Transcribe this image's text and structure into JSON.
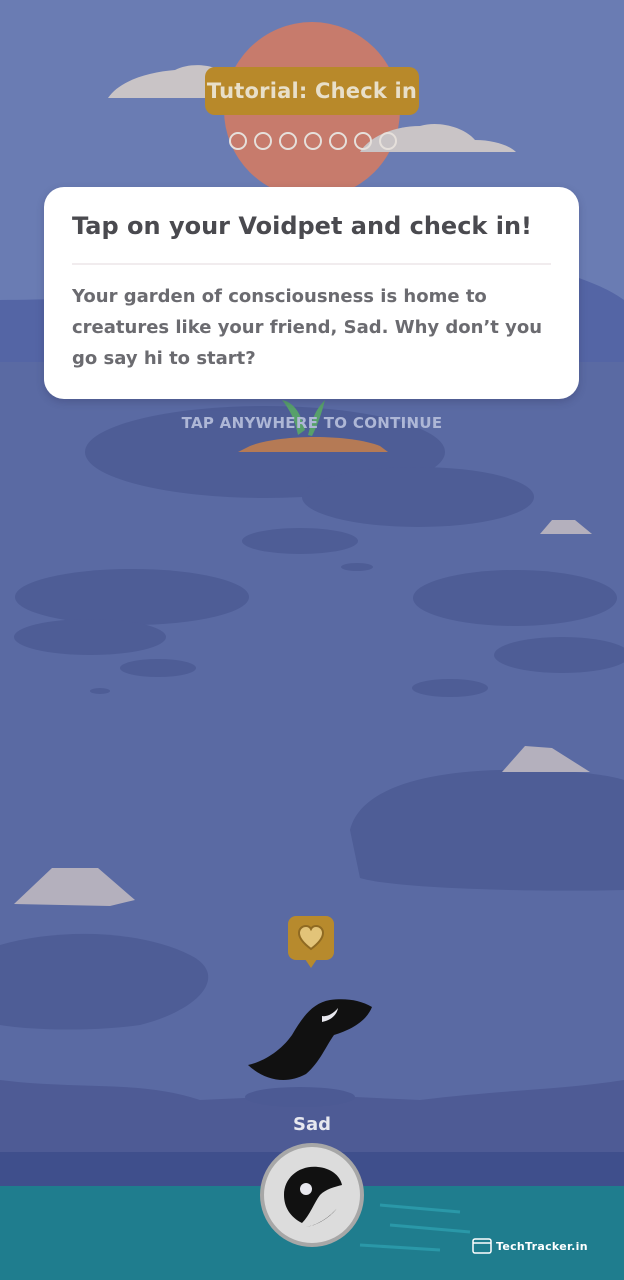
{
  "tutorial": {
    "title": "Tutorial: Check in",
    "total_steps": 7,
    "current_step": 0
  },
  "card": {
    "title": "Tap on your Voidpet and check in!",
    "body": "Your garden of consciousness is home to creatures like your friend, Sad. Why don’t you go say hi to start?"
  },
  "hint": "TAP ANYWHERE TO CONTINUE",
  "pet": {
    "name": "Sad",
    "mood_icon": "heart-icon"
  },
  "watermark": "TechTracker.in",
  "colors": {
    "sky": "#6a7cb3",
    "ground": "#5a6aa3",
    "accent": "#b8892a",
    "water": "#1f7d8e"
  }
}
